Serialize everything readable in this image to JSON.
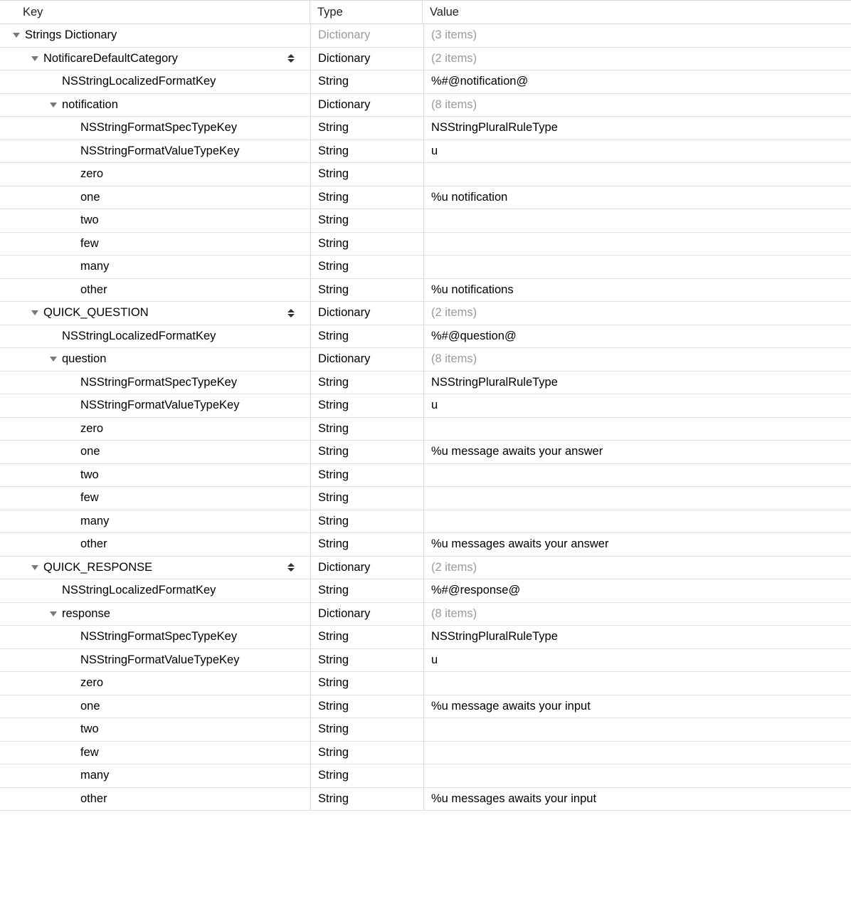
{
  "headers": {
    "key": "Key",
    "type": "Type",
    "value": "Value"
  },
  "rows": [
    {
      "indent": 0,
      "tri": true,
      "key": "Strings Dictionary",
      "type": "Dictionary",
      "typeGrey": true,
      "value": "(3 items)",
      "valueGrey": true,
      "stepper": false
    },
    {
      "indent": 1,
      "tri": true,
      "key": "NotificareDefaultCategory",
      "type": "Dictionary",
      "typeGrey": false,
      "value": "(2 items)",
      "valueGrey": true,
      "stepper": true
    },
    {
      "indent": 2,
      "tri": false,
      "key": "NSStringLocalizedFormatKey",
      "type": "String",
      "typeGrey": false,
      "value": "%#@notification@",
      "valueGrey": false,
      "stepper": false
    },
    {
      "indent": 2,
      "tri": true,
      "key": "notification",
      "type": "Dictionary",
      "typeGrey": false,
      "value": "(8 items)",
      "valueGrey": true,
      "stepper": false
    },
    {
      "indent": 3,
      "tri": false,
      "key": "NSStringFormatSpecTypeKey",
      "type": "String",
      "typeGrey": false,
      "value": "NSStringPluralRuleType",
      "valueGrey": false,
      "stepper": false
    },
    {
      "indent": 3,
      "tri": false,
      "key": "NSStringFormatValueTypeKey",
      "type": "String",
      "typeGrey": false,
      "value": "u",
      "valueGrey": false,
      "stepper": false
    },
    {
      "indent": 3,
      "tri": false,
      "key": "zero",
      "type": "String",
      "typeGrey": false,
      "value": "",
      "valueGrey": false,
      "stepper": false
    },
    {
      "indent": 3,
      "tri": false,
      "key": "one",
      "type": "String",
      "typeGrey": false,
      "value": "%u notification",
      "valueGrey": false,
      "stepper": false
    },
    {
      "indent": 3,
      "tri": false,
      "key": "two",
      "type": "String",
      "typeGrey": false,
      "value": "",
      "valueGrey": false,
      "stepper": false
    },
    {
      "indent": 3,
      "tri": false,
      "key": "few",
      "type": "String",
      "typeGrey": false,
      "value": "",
      "valueGrey": false,
      "stepper": false
    },
    {
      "indent": 3,
      "tri": false,
      "key": "many",
      "type": "String",
      "typeGrey": false,
      "value": "",
      "valueGrey": false,
      "stepper": false
    },
    {
      "indent": 3,
      "tri": false,
      "key": "other",
      "type": "String",
      "typeGrey": false,
      "value": "%u notifications",
      "valueGrey": false,
      "stepper": false
    },
    {
      "indent": 1,
      "tri": true,
      "key": "QUICK_QUESTION",
      "type": "Dictionary",
      "typeGrey": false,
      "value": "(2 items)",
      "valueGrey": true,
      "stepper": true
    },
    {
      "indent": 2,
      "tri": false,
      "key": "NSStringLocalizedFormatKey",
      "type": "String",
      "typeGrey": false,
      "value": "%#@question@",
      "valueGrey": false,
      "stepper": false
    },
    {
      "indent": 2,
      "tri": true,
      "key": "question",
      "type": "Dictionary",
      "typeGrey": false,
      "value": "(8 items)",
      "valueGrey": true,
      "stepper": false
    },
    {
      "indent": 3,
      "tri": false,
      "key": "NSStringFormatSpecTypeKey",
      "type": "String",
      "typeGrey": false,
      "value": "NSStringPluralRuleType",
      "valueGrey": false,
      "stepper": false
    },
    {
      "indent": 3,
      "tri": false,
      "key": "NSStringFormatValueTypeKey",
      "type": "String",
      "typeGrey": false,
      "value": "u",
      "valueGrey": false,
      "stepper": false
    },
    {
      "indent": 3,
      "tri": false,
      "key": "zero",
      "type": "String",
      "typeGrey": false,
      "value": "",
      "valueGrey": false,
      "stepper": false
    },
    {
      "indent": 3,
      "tri": false,
      "key": "one",
      "type": "String",
      "typeGrey": false,
      "value": "%u message awaits your answer",
      "valueGrey": false,
      "stepper": false
    },
    {
      "indent": 3,
      "tri": false,
      "key": "two",
      "type": "String",
      "typeGrey": false,
      "value": "",
      "valueGrey": false,
      "stepper": false
    },
    {
      "indent": 3,
      "tri": false,
      "key": "few",
      "type": "String",
      "typeGrey": false,
      "value": "",
      "valueGrey": false,
      "stepper": false
    },
    {
      "indent": 3,
      "tri": false,
      "key": "many",
      "type": "String",
      "typeGrey": false,
      "value": "",
      "valueGrey": false,
      "stepper": false
    },
    {
      "indent": 3,
      "tri": false,
      "key": "other",
      "type": "String",
      "typeGrey": false,
      "value": "%u messages awaits your answer",
      "valueGrey": false,
      "stepper": false
    },
    {
      "indent": 1,
      "tri": true,
      "key": "QUICK_RESPONSE",
      "type": "Dictionary",
      "typeGrey": false,
      "value": "(2 items)",
      "valueGrey": true,
      "stepper": true
    },
    {
      "indent": 2,
      "tri": false,
      "key": "NSStringLocalizedFormatKey",
      "type": "String",
      "typeGrey": false,
      "value": "%#@response@",
      "valueGrey": false,
      "stepper": false
    },
    {
      "indent": 2,
      "tri": true,
      "key": "response",
      "type": "Dictionary",
      "typeGrey": false,
      "value": "(8 items)",
      "valueGrey": true,
      "stepper": false
    },
    {
      "indent": 3,
      "tri": false,
      "key": "NSStringFormatSpecTypeKey",
      "type": "String",
      "typeGrey": false,
      "value": "NSStringPluralRuleType",
      "valueGrey": false,
      "stepper": false
    },
    {
      "indent": 3,
      "tri": false,
      "key": "NSStringFormatValueTypeKey",
      "type": "String",
      "typeGrey": false,
      "value": "u",
      "valueGrey": false,
      "stepper": false
    },
    {
      "indent": 3,
      "tri": false,
      "key": "zero",
      "type": "String",
      "typeGrey": false,
      "value": "",
      "valueGrey": false,
      "stepper": false
    },
    {
      "indent": 3,
      "tri": false,
      "key": "one",
      "type": "String",
      "typeGrey": false,
      "value": "%u message awaits your input",
      "valueGrey": false,
      "stepper": false
    },
    {
      "indent": 3,
      "tri": false,
      "key": "two",
      "type": "String",
      "typeGrey": false,
      "value": "",
      "valueGrey": false,
      "stepper": false
    },
    {
      "indent": 3,
      "tri": false,
      "key": "few",
      "type": "String",
      "typeGrey": false,
      "value": "",
      "valueGrey": false,
      "stepper": false
    },
    {
      "indent": 3,
      "tri": false,
      "key": "many",
      "type": "String",
      "typeGrey": false,
      "value": "",
      "valueGrey": false,
      "stepper": false
    },
    {
      "indent": 3,
      "tri": false,
      "key": "other",
      "type": "String",
      "typeGrey": false,
      "value": "%u messages awaits your input",
      "valueGrey": false,
      "stepper": false
    }
  ]
}
